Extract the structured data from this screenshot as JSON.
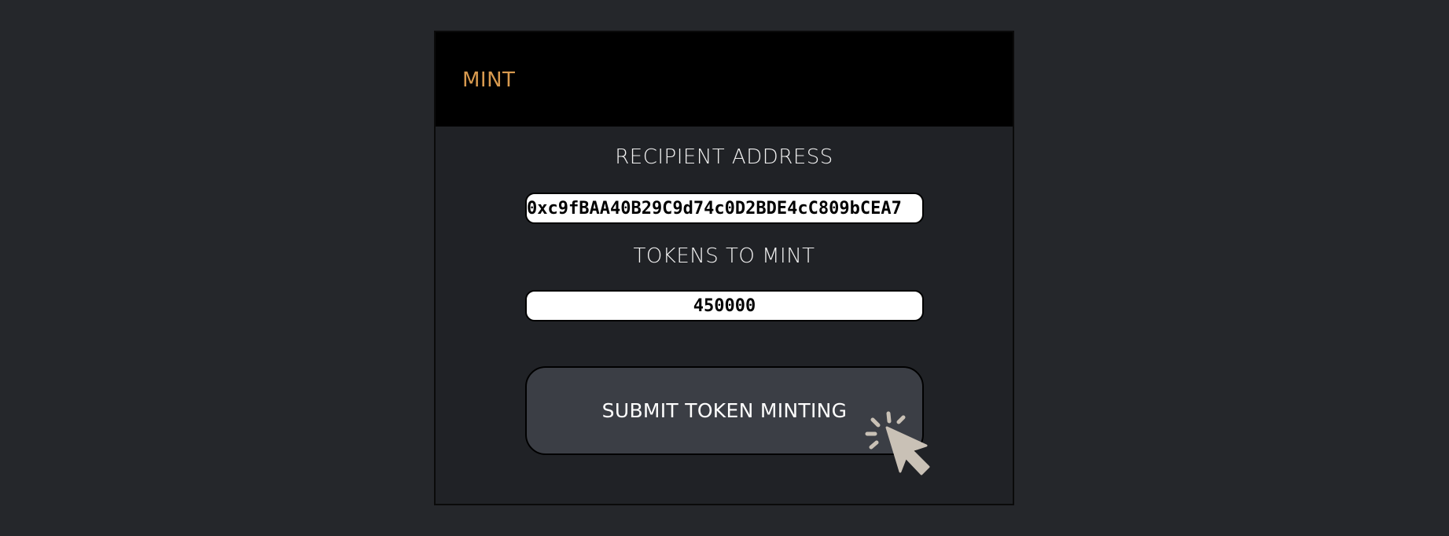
{
  "card": {
    "title": "MINT"
  },
  "form": {
    "recipient_label": "RECIPIENT ADDRESS",
    "recipient_value": "0xc9fBAA40B29C9d74c0D2BDE4cC809bCEA7",
    "tokens_label": "TOKENS TO MINT",
    "tokens_value": "450000",
    "submit_label": "SUBMIT TOKEN MINTING"
  },
  "colors": {
    "page_background": "#25272b",
    "card_background": "#202226",
    "header_background": "#000000",
    "title_accent": "#d89a4f",
    "button_background": "#3b3e45",
    "cursor_color": "#c9c1b6"
  },
  "icons": {
    "cursor": "click-cursor-icon"
  }
}
